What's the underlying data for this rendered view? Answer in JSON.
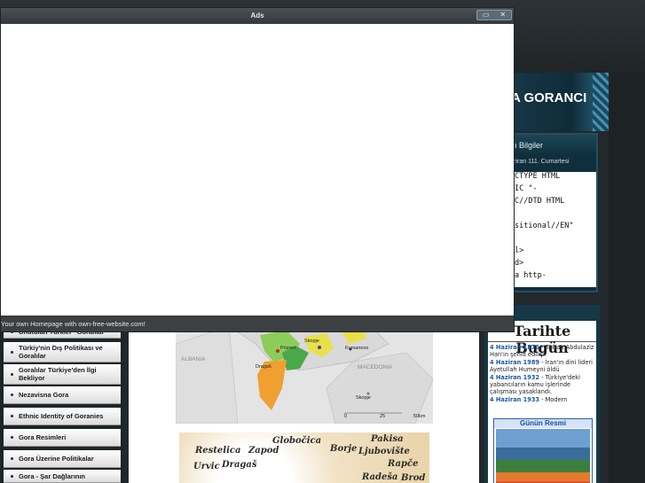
{
  "ads_window": {
    "title": "Ads",
    "status_text": "Your own Homepage with own-free-website.com!",
    "controls": [
      "▭",
      "✕"
    ]
  },
  "site": {
    "banner_title": "A GORANCI",
    "side_box": {
      "heading": "lı Bilgiler",
      "date": "ziran 111. Cumartesi",
      "code_lines": [
        "CTYPE HTML",
        "IC \"-",
        "C//DTD HTML",
        "",
        "sitional//EN\"",
        "",
        "l>",
        "d>",
        "a http-"
      ]
    },
    "tarihte": {
      "title": "Tarihte Bugün",
      "entries": [
        {
          "date": "4 Haziran 1876",
          "text": " - Sultan Abdulaziz Han'ın şehid edilişi."
        },
        {
          "date": "4 Haziran 1989",
          "text": " - İran'ın dini lideri Ayetullah Humeyni öldü"
        },
        {
          "date": "4 Haziran 1932",
          "text": " - Türkiye'deki yabancıların kamu işlerinde çalışması yasaklandı."
        },
        {
          "date": "4 Haziran 1933",
          "text": " - Modern"
        }
      ],
      "gunun_resmi": "Günün Resmi"
    },
    "nav": [
      "Unutulan Türkler \"Goralılar\"",
      "Türkiy'nin Dış Politikası ve Goralılar",
      "Goralılar Türkiye'den İlgi Bekliyor",
      "Nezavisna Gora",
      "Ethnic Identity of Goranies",
      "Gora Resimleri",
      "Gora Üzerine Politikalar",
      "Gora - Şar Dağlarının"
    ],
    "map": {
      "labels": {
        "albania": "ALBANIA",
        "macedonia": "MACEDONIA"
      },
      "cities": {
        "prizren": "Prizren",
        "skopje_top": "Skopje",
        "kumanovo": "Kumanovo",
        "dragas": "Dragaš",
        "skopje": "Skopje"
      },
      "scale": [
        "0",
        "25",
        "50km"
      ]
    },
    "poster_words": [
      "Globočica",
      "Pakisa",
      "Restelica",
      "Zapod",
      "Borje",
      "Ljubovište",
      "Urvic",
      "Dragaš",
      "Rapče",
      "Radeša",
      "Brod"
    ]
  },
  "colors": {
    "ads_title_bar": "#3d4043",
    "background": "#22282b",
    "banner": "#0e2b38",
    "tarihte_date": "#1a5aa0"
  }
}
